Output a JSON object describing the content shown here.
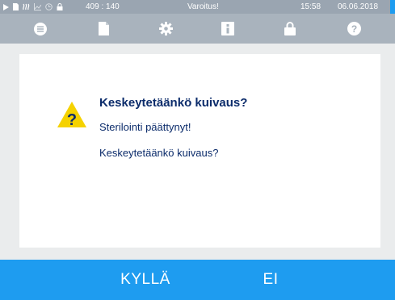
{
  "status_bar": {
    "icons": [
      "play-icon",
      "document-icon",
      "steam-icon",
      "graph-icon",
      "clock-icon",
      "lock-icon"
    ],
    "counter": "409 : 140",
    "warning_label": "Varoitus!",
    "time": "15:58",
    "date": "06.06.2018"
  },
  "nav": {
    "items": [
      "menu-icon",
      "document-icon",
      "gear-icon",
      "info-icon",
      "lock-icon",
      "help-icon"
    ]
  },
  "dialog": {
    "title": "Keskeytetäänkö kuivaus?",
    "line1": "Sterilointi päättynyt!",
    "line2": "Keskeytetäänkö kuivaus?",
    "icon": "warning-question-icon"
  },
  "buttons": {
    "yes_label": "KYLLÄ",
    "no_label": "EI"
  },
  "colors": {
    "status_bar": "#9aa5b1",
    "nav_bar": "#a9b3bd",
    "accent": "#1e9cf0",
    "text": "#0c2c6b",
    "warning": "#f5d200"
  }
}
